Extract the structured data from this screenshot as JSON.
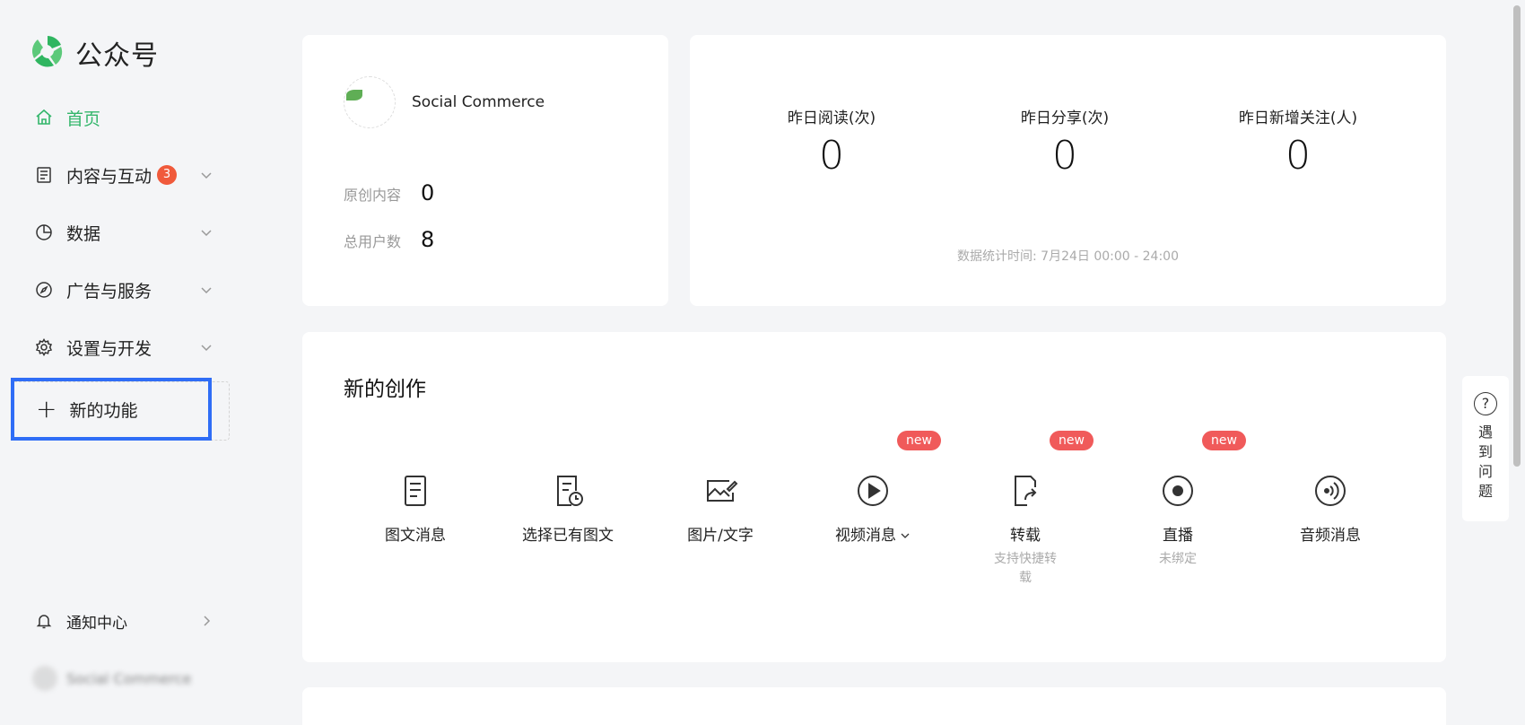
{
  "app": {
    "title": "公众号"
  },
  "sidebar": {
    "items": [
      {
        "label": "首页",
        "icon": "home-icon",
        "active": true
      },
      {
        "label": "内容与互动",
        "icon": "document-icon",
        "badge": "3"
      },
      {
        "label": "数据",
        "icon": "pie-chart-icon"
      },
      {
        "label": "广告与服务",
        "icon": "compass-icon"
      },
      {
        "label": "设置与开发",
        "icon": "gear-icon"
      }
    ],
    "new_feature": "新的功能",
    "notification": "通知中心",
    "user_name": "Social Commerce"
  },
  "profile": {
    "name": "Social Commerce",
    "original_label": "原创内容",
    "original_value": "0",
    "users_label": "总用户数",
    "users_value": "8"
  },
  "stats": {
    "items": [
      {
        "label": "昨日阅读(次)",
        "value": "0"
      },
      {
        "label": "昨日分享(次)",
        "value": "0"
      },
      {
        "label": "昨日新增关注(人)",
        "value": "0"
      }
    ],
    "time_note": "数据统计时间: 7月24日 00:00 - 24:00"
  },
  "create": {
    "title": "新的创作",
    "new_badge": "new",
    "tools": [
      {
        "label": "图文消息",
        "icon": "article-icon"
      },
      {
        "label": "选择已有图文",
        "icon": "article-history-icon"
      },
      {
        "label": "图片/文字",
        "icon": "image-text-icon"
      },
      {
        "label": "视频消息",
        "icon": "play-icon",
        "new": true
      },
      {
        "label": "转载",
        "icon": "repost-icon",
        "new": true,
        "sub": "支持快捷转载"
      },
      {
        "label": "直播",
        "icon": "live-icon",
        "new": true,
        "sub": "未绑定"
      },
      {
        "label": "音频消息",
        "icon": "audio-icon"
      }
    ]
  },
  "help": {
    "text": "遇到问题"
  },
  "colors": {
    "accent": "#33b66b",
    "badge": "#f05a3b",
    "new_badge": "#f05a5a",
    "highlight": "#2f6df6"
  }
}
